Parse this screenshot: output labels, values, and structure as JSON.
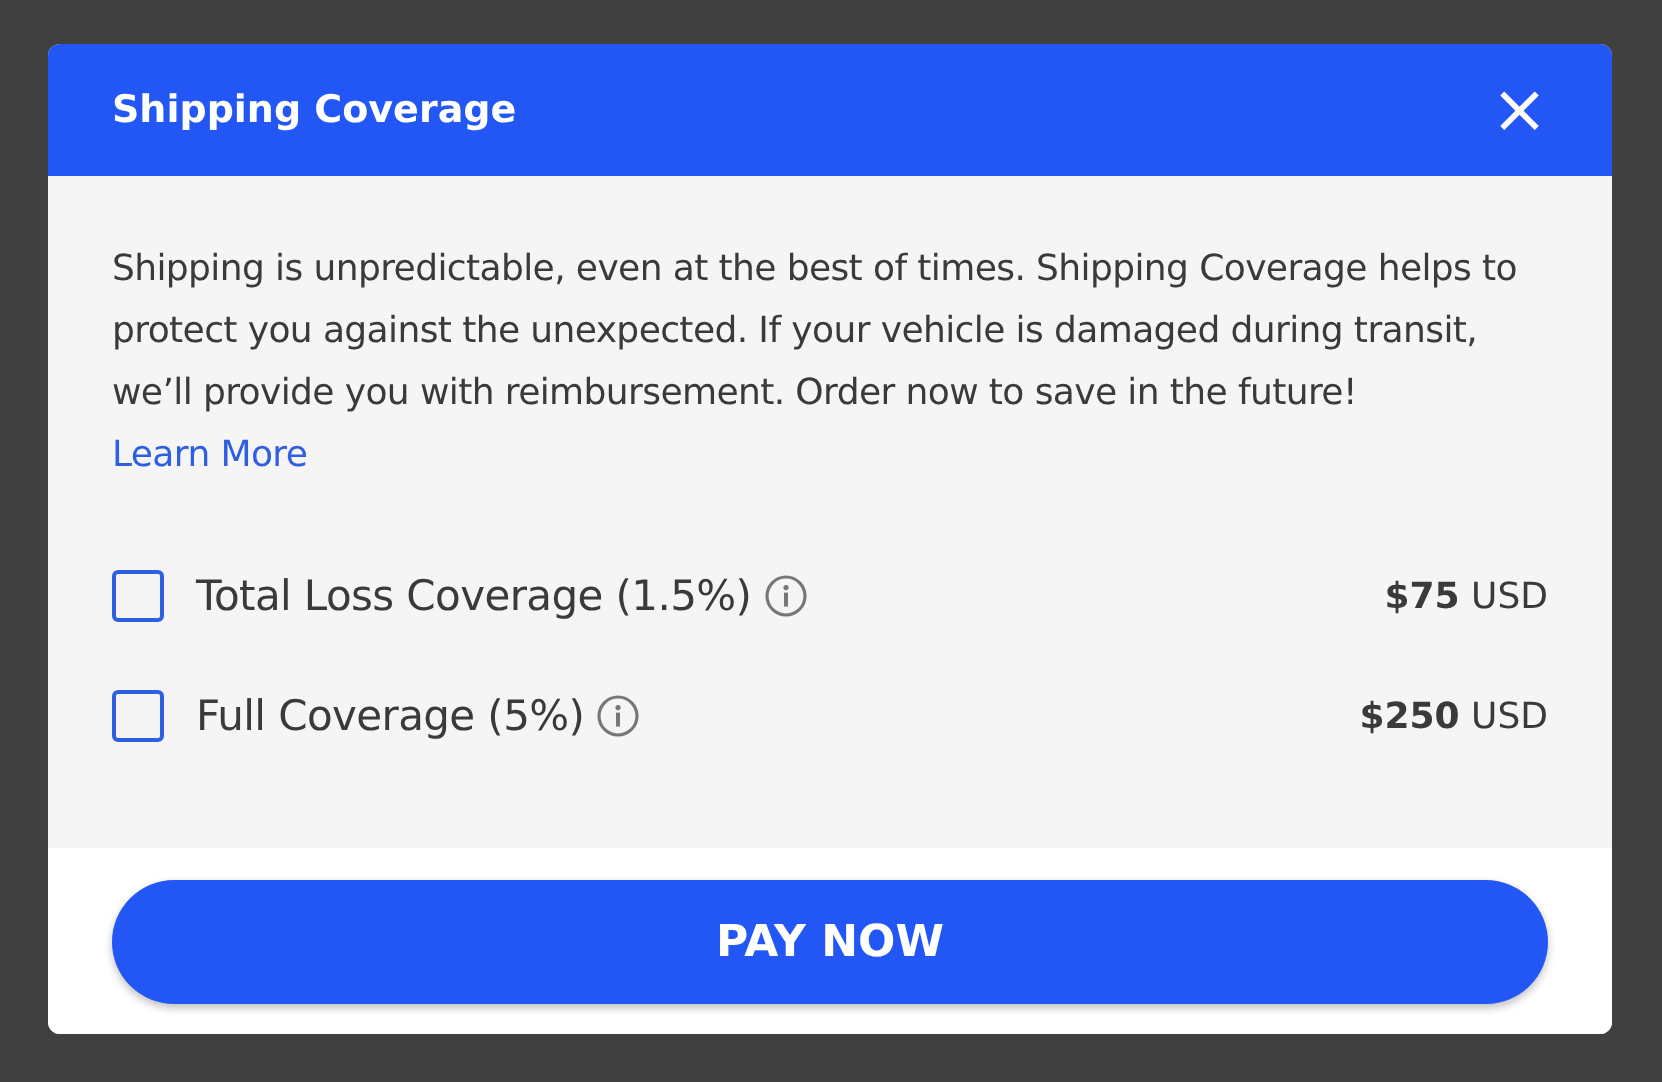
{
  "dialog": {
    "title": "Shipping Coverage",
    "close": "×",
    "description": "Shipping is unpredictable, even at the best of times. Shipping Coverage helps to protect you against the unexpected. If your vehicle is damaged during transit, we’ll provide you with reimbursement. Order now to save in the future!",
    "link": "Learn More",
    "options": [
      {
        "label": "Total Loss Coverage (1.5%)",
        "amount": "$75",
        "currency": "USD",
        "checked": false
      },
      {
        "label": "Full Coverage (5%)",
        "amount": "$250",
        "currency": "USD",
        "checked": false
      }
    ],
    "button": "PAY NOW"
  }
}
